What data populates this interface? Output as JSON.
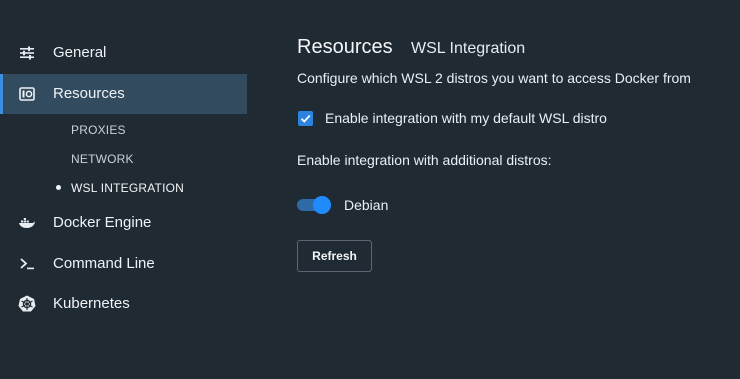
{
  "sidebar": {
    "items": [
      {
        "label": "General",
        "icon": "sliders-icon"
      },
      {
        "label": "Resources",
        "icon": "resources-icon",
        "active": true
      },
      {
        "label": "Docker Engine",
        "icon": "whale-icon"
      },
      {
        "label": "Command Line",
        "icon": "terminal-icon"
      },
      {
        "label": "Kubernetes",
        "icon": "kubernetes-helm-icon"
      }
    ],
    "sub_items": [
      {
        "label": "PROXIES"
      },
      {
        "label": "NETWORK"
      },
      {
        "label": "WSL INTEGRATION",
        "current": true
      }
    ]
  },
  "main": {
    "title": "Resources",
    "subtitle": "WSL Integration",
    "description": "Configure which WSL 2 distros you want to access Docker from",
    "default_distro_checkbox": {
      "label": "Enable integration with my default WSL distro",
      "checked": true
    },
    "additional_label": "Enable integration with additional distros:",
    "distros": [
      {
        "name": "Debian",
        "enabled": true
      }
    ],
    "refresh_label": "Refresh"
  },
  "colors": {
    "background": "#202a33",
    "active_nav": "#334b5f",
    "accent": "#2d83e0",
    "toggle_knob": "#1f8bff"
  }
}
